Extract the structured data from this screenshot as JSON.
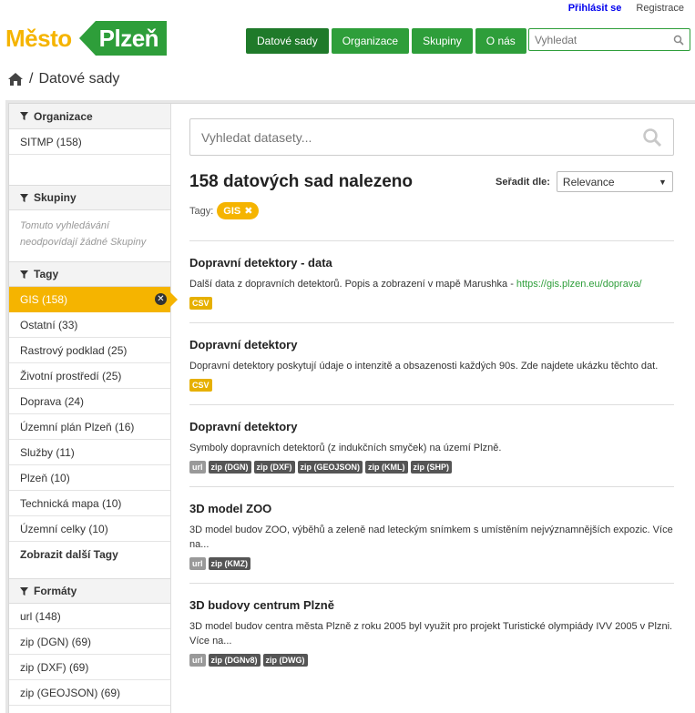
{
  "header": {
    "login": "Přihlásit se",
    "register": "Registrace",
    "logo_left": "Město",
    "logo_right": "Plzeň",
    "nav": [
      "Datové sady",
      "Organizace",
      "Skupiny",
      "O nás"
    ],
    "search_placeholder": "Vyhledat"
  },
  "breadcrumb": {
    "current": "Datové sady"
  },
  "sidebar": {
    "organizations": {
      "title": "Organizace",
      "items": [
        "SITMP (158)"
      ]
    },
    "groups": {
      "title": "Skupiny",
      "empty_text": "Tomuto vyhledávání neodpovídají žádné Skupiny"
    },
    "tags": {
      "title": "Tagy",
      "items": [
        "GIS (158)",
        "Ostatní (33)",
        "Rastrový podklad (25)",
        "Životní prostředí (25)",
        "Doprava (24)",
        "Územní plán Plzeň (16)",
        "Služby (11)",
        "Plzeň (10)",
        "Technická mapa (10)",
        "Územní celky (10)"
      ],
      "more": "Zobrazit další Tagy"
    },
    "formats": {
      "title": "Formáty",
      "items": [
        "url (148)",
        "zip (DGN) (69)",
        "zip (DXF) (69)",
        "zip (GEOJSON) (69)"
      ]
    }
  },
  "main": {
    "search_placeholder": "Vyhledat datasety...",
    "result_count": "158 datových sad nalezeno",
    "sort_label": "Seřadit dle:",
    "sort_value": "Relevance",
    "tags_label": "Tagy:",
    "active_tag": "GIS",
    "datasets": [
      {
        "title": "Dopravní detektory - data",
        "desc": "Další data z dopravních detektorů. Popis a zobrazení v mapě Marushka - ",
        "link": "https://gis.plzen.eu/doprava/",
        "formats": [
          "CSV"
        ]
      },
      {
        "title": "Dopravní detektory",
        "desc": "Dopravní detektory poskytují údaje o intenzitě a obsazenosti každých 90s. Zde najdete ukázku těchto dat.",
        "formats": [
          "CSV"
        ]
      },
      {
        "title": "Dopravní detektory",
        "desc": "Symboly dopravních detektorů (z indukčních smyček) na území Plzně.",
        "formats": [
          "url",
          "zip (DGN)",
          "zip (DXF)",
          "zip (GEOJSON)",
          "zip (KML)",
          "zip (SHP)"
        ]
      },
      {
        "title": "3D model ZOO",
        "desc": "3D model budov ZOO, výběhů a zeleně nad leteckým snímkem s umístěním nejvýznamnějších expozic. Více na...",
        "formats": [
          "url",
          "zip (KMZ)"
        ]
      },
      {
        "title": "3D budovy centrum Plzně",
        "desc": "3D model budov centra města Plzně z roku 2005 byl využit pro projekt Turistické olympiády IVV 2005 v Plzni. Více na...",
        "formats": [
          "url",
          "zip (DGNv8)",
          "zip (DWG)"
        ]
      }
    ]
  }
}
